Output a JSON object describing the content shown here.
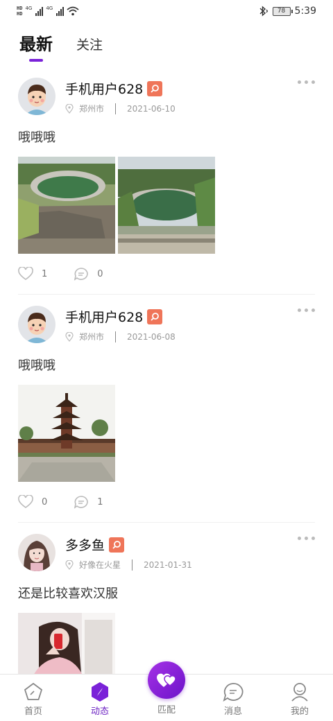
{
  "status_bar": {
    "left_hd_top": "HD",
    "left_hd_bottom": "HD",
    "sig1_label": "4G",
    "sig2_label": "4G",
    "battery": "78",
    "time": "5:39"
  },
  "tabs": [
    {
      "label": "最新",
      "active": true
    },
    {
      "label": "关注",
      "active": false
    }
  ],
  "posts": [
    {
      "user": "手机用户628",
      "location": "郑州市",
      "date": "2021-06-10",
      "text": "哦哦哦",
      "likes": "1",
      "comments": "0",
      "avatar_icon": "cartoon-boy-avatar",
      "images": [
        "green-pond-photo",
        "green-pond-photo"
      ]
    },
    {
      "user": "手机用户628",
      "location": "郑州市",
      "date": "2021-06-08",
      "text": "哦哦哦",
      "likes": "0",
      "comments": "1",
      "avatar_icon": "cartoon-boy-avatar",
      "images": [
        "pagoda-photo"
      ]
    },
    {
      "user": "多多鱼",
      "location": "好像在火星",
      "date": "2021-01-31",
      "text": "还是比较喜欢汉服",
      "likes": "",
      "comments": "",
      "avatar_icon": "girl-photo-avatar",
      "images": [
        "girl-selfie-photo"
      ]
    }
  ],
  "bottom_nav": [
    {
      "label": "首页",
      "icon": "home-pentagon-icon",
      "active": false
    },
    {
      "label": "动态",
      "icon": "compass-hexagon-icon",
      "active": true
    },
    {
      "label": "匹配",
      "icon": "hearts-icon",
      "active": false
    },
    {
      "label": "消息",
      "icon": "chat-icon",
      "active": false
    },
    {
      "label": "我的",
      "icon": "user-icon",
      "active": false
    }
  ],
  "colors": {
    "accent": "#7a22d8",
    "badge": "#ef7559",
    "match_button": "#8b24d8"
  }
}
